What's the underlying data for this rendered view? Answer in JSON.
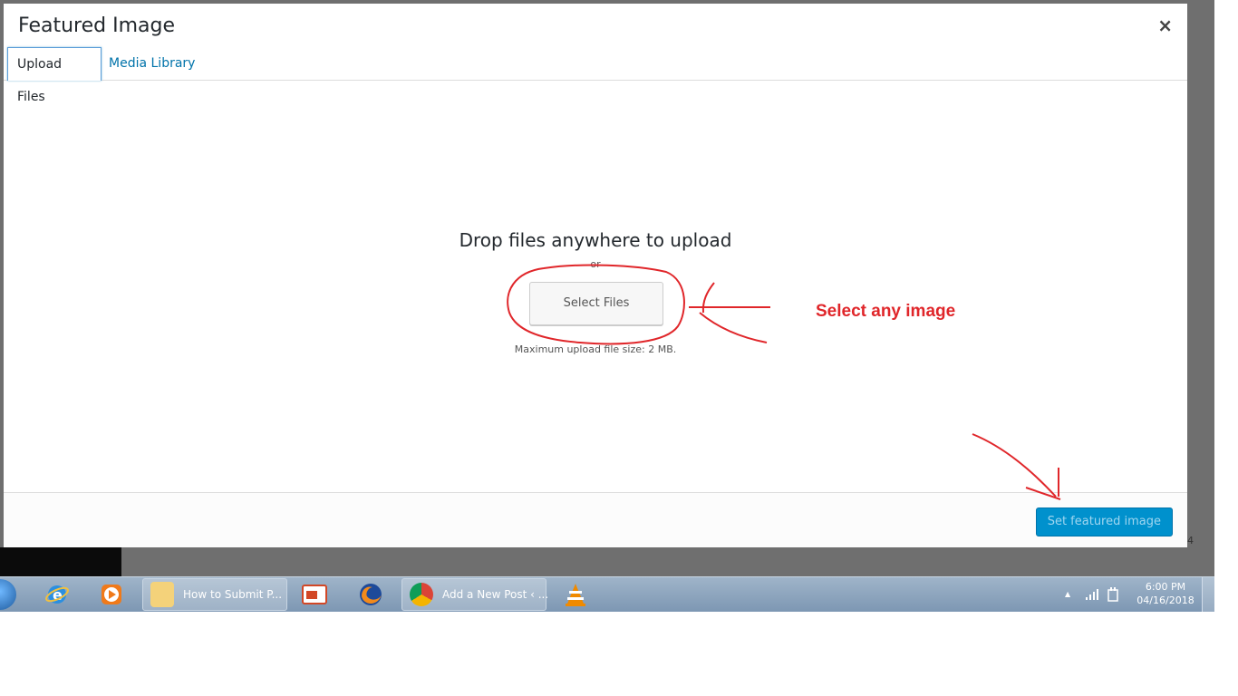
{
  "modal": {
    "title": "Featured Image",
    "close_glyph": "×",
    "tabs": [
      {
        "label": "Upload Files",
        "active": true
      },
      {
        "label": "Media Library",
        "active": false
      }
    ],
    "upload": {
      "drop_text": "Drop files anywhere to upload",
      "or_text": "or",
      "select_button": "Select Files",
      "max_size": "Maximum upload file size: 2 MB."
    },
    "footer": {
      "set_button": "Set featured image"
    }
  },
  "annotation": {
    "text": "Select any image",
    "color": "#e0262a"
  },
  "background": {
    "edge_number": "4"
  },
  "taskbar": {
    "buttons": [
      {
        "label": "How to Submit P..."
      },
      {
        "label": "Add a New Post ‹ ..."
      }
    ],
    "clock": {
      "time": "6:00 PM",
      "date": "04/16/2018"
    },
    "tray_arrow": "▲"
  },
  "colors": {
    "accent": "#0073aa",
    "primary_button": "#0091cd"
  },
  "icons": [
    "close-icon",
    "windows-start-icon",
    "internet-explorer-icon",
    "media-player-icon",
    "folder-icon",
    "powerpoint-icon",
    "firefox-icon",
    "chrome-icon",
    "vlc-icon",
    "signal-icon",
    "power-icon"
  ]
}
